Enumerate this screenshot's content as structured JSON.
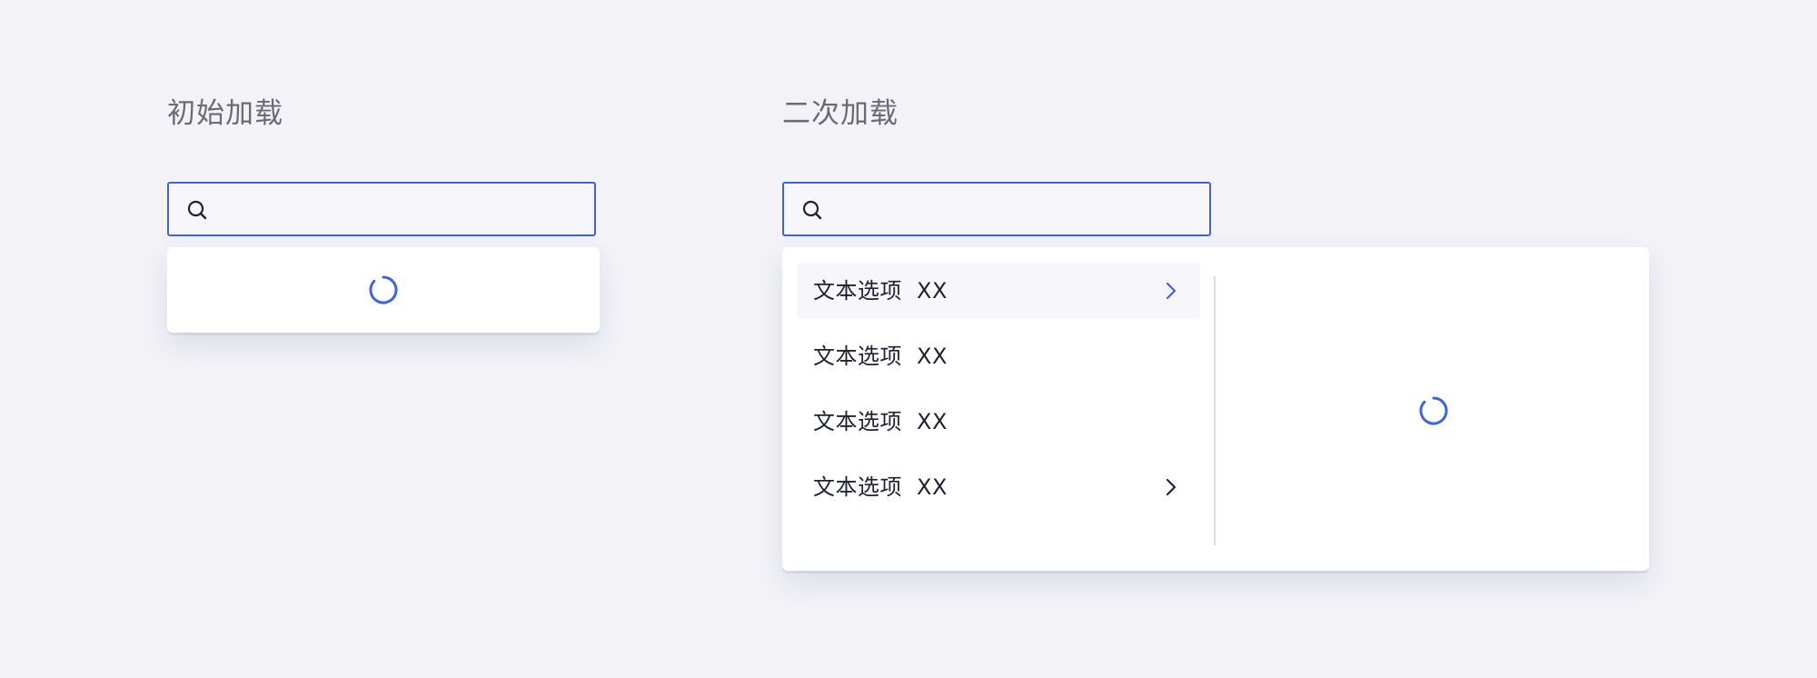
{
  "sections": [
    {
      "title": "初始加载",
      "search": {
        "value": "",
        "placeholder": ""
      }
    },
    {
      "title": "二次加载",
      "search": {
        "value": "",
        "placeholder": ""
      },
      "options": [
        {
          "label": "文本选项",
          "suffix": "XX",
          "has_submenu": true,
          "highlighted": true
        },
        {
          "label": "文本选项",
          "suffix": "XX",
          "has_submenu": false,
          "highlighted": false
        },
        {
          "label": "文本选项",
          "suffix": "XX",
          "has_submenu": false,
          "highlighted": false
        },
        {
          "label": "文本选项",
          "suffix": "XX",
          "has_submenu": true,
          "highlighted": false
        }
      ]
    }
  ],
  "icons": {
    "search": "search-icon",
    "spinner": "loading-spinner-icon",
    "chevron": "chevron-right-icon"
  },
  "colors": {
    "background": "#f2f2f7",
    "accent": "#3d63dd",
    "text": "#1f2233",
    "title": "#6b6b73"
  }
}
